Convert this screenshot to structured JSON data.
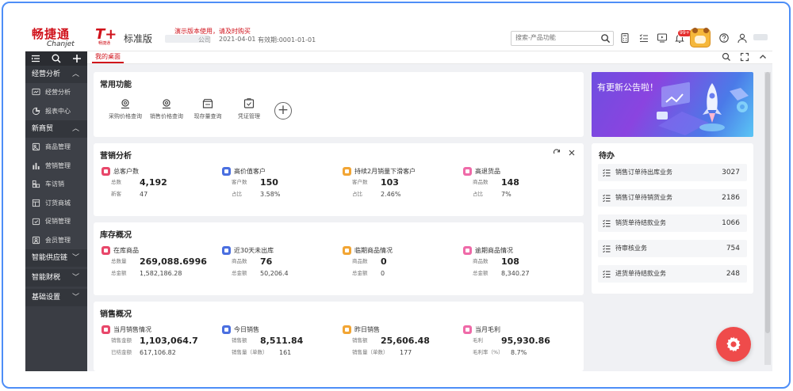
{
  "brand": {
    "logo_cn": "畅捷通",
    "logo_en": "Chanjet",
    "product": "T+",
    "product_sub": "畅捷通",
    "edition": "标准版"
  },
  "header": {
    "demo_note": "演示版本使用，请及时购买",
    "company_suffix": "公司",
    "date": "2021-04-01",
    "validity": "有效期:0001-01-01",
    "search_placeholder": "搜索-产品功能",
    "notification_badge": "99+"
  },
  "sidebar": {
    "groups": [
      {
        "label": "经营分析",
        "expanded": true,
        "items": [
          "经营分析",
          "报表中心"
        ]
      },
      {
        "label": "新商贸",
        "expanded": true,
        "items": [
          "商品管理",
          "营销管理",
          "车访销",
          "订货商城",
          "促销管理",
          "会员管理"
        ]
      },
      {
        "label": "智能供应链",
        "expanded": false,
        "items": []
      },
      {
        "label": "智能财税",
        "expanded": false,
        "items": []
      },
      {
        "label": "基础设置",
        "expanded": false,
        "items": []
      }
    ]
  },
  "tabs": [
    {
      "label": "我的桌面",
      "active": true
    }
  ],
  "quick_actions": {
    "title": "常用功能",
    "items": [
      "采购价格查询",
      "销售价格查询",
      "现存量查询",
      "凭证管理"
    ]
  },
  "marketing": {
    "title": "营销分析",
    "stats": [
      {
        "title": "总客户数",
        "color": "#e8476a",
        "rows": [
          {
            "label": "总数",
            "value": "4,192"
          },
          {
            "label": "新客",
            "value": "47"
          }
        ]
      },
      {
        "title": "高价值客户",
        "color": "#4a6fe0",
        "rows": [
          {
            "label": "客户数",
            "value": "150"
          },
          {
            "label": "占比",
            "value": "3.58%"
          }
        ]
      },
      {
        "title": "持续2月销量下滑客户",
        "color": "#f2a534",
        "rows": [
          {
            "label": "客户数",
            "value": "103"
          },
          {
            "label": "占比",
            "value": "2.46%"
          }
        ]
      },
      {
        "title": "高退货品",
        "color": "#ef6aa8",
        "rows": [
          {
            "label": "商品数",
            "value": "148"
          },
          {
            "label": "占比",
            "value": "7%"
          }
        ]
      }
    ]
  },
  "inventory": {
    "title": "库存概况",
    "stats": [
      {
        "title": "在库商品",
        "color": "#e8476a",
        "rows": [
          {
            "label": "总数量",
            "value": "269,088.6996"
          },
          {
            "label": "总金额",
            "value": "1,582,186.28"
          }
        ]
      },
      {
        "title": "近30天未出库",
        "color": "#4a6fe0",
        "rows": [
          {
            "label": "商品数",
            "value": "76"
          },
          {
            "label": "总金额",
            "value": "50,206.4"
          }
        ]
      },
      {
        "title": "临期商品情况",
        "color": "#f2a534",
        "rows": [
          {
            "label": "商品数",
            "value": "0"
          },
          {
            "label": "总金额",
            "value": "0"
          }
        ]
      },
      {
        "title": "逾期商品情况",
        "color": "#ef6aa8",
        "rows": [
          {
            "label": "商品数",
            "value": "108"
          },
          {
            "label": "总金额",
            "value": "8,340.27"
          }
        ]
      }
    ]
  },
  "sales": {
    "title": "销售概况",
    "stats": [
      {
        "title": "当月销售情况",
        "color": "#e8476a",
        "rows": [
          {
            "label": "销售金额",
            "value": "1,103,064.7"
          },
          {
            "label": "已结金额",
            "value": "617,106.82"
          }
        ]
      },
      {
        "title": "今日销售",
        "color": "#4a6fe0",
        "rows": [
          {
            "label": "销售额",
            "value": "8,511.84"
          },
          {
            "label": "销售量（单数）",
            "value": "161"
          }
        ]
      },
      {
        "title": "昨日销售",
        "color": "#f2a534",
        "rows": [
          {
            "label": "销售额",
            "value": "25,606.48"
          },
          {
            "label": "销售量（单数）",
            "value": "177"
          }
        ]
      },
      {
        "title": "当月毛利",
        "color": "#ef6aa8",
        "rows": [
          {
            "label": "毛利",
            "value": "95,930.86"
          },
          {
            "label": "毛利率（%）",
            "value": "8.7%"
          }
        ]
      }
    ]
  },
  "banner": {
    "text": "有更新公告啦！"
  },
  "todo": {
    "title": "待办",
    "items": [
      {
        "label": "销售订单待出库业务",
        "count": "3027"
      },
      {
        "label": "销售订单待销货业务",
        "count": "2186"
      },
      {
        "label": "销货单待结款业务",
        "count": "1066"
      },
      {
        "label": "待审核业务",
        "count": "754"
      },
      {
        "label": "进货单待结款业务",
        "count": "248"
      }
    ]
  },
  "colors": {
    "brand_red": "#d0121b",
    "sidebar_bg": "#3a3d44",
    "fab": "#ef4b4b"
  }
}
